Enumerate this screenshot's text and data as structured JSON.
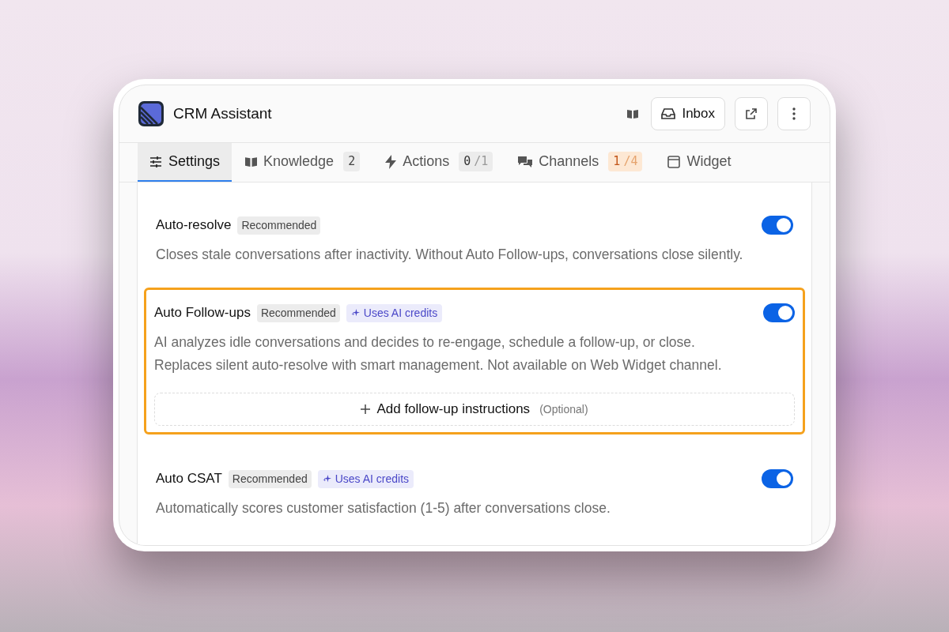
{
  "app": {
    "title": "CRM Assistant",
    "inbox_button": "Inbox"
  },
  "tabs": [
    {
      "label": "Settings",
      "selected": true
    },
    {
      "label": "Knowledge",
      "selected": false,
      "count": "2",
      "kind": "plain"
    },
    {
      "label": "Actions",
      "selected": false,
      "count": "0",
      "total": "/1",
      "kind": "neutral"
    },
    {
      "label": "Channels",
      "selected": false,
      "count": "1",
      "total": "/4",
      "kind": "warning"
    },
    {
      "label": "Widget",
      "selected": false
    }
  ],
  "settings": [
    {
      "title": "Auto-resolve",
      "badges": [
        {
          "kind": "recommended",
          "label": "Recommended"
        }
      ],
      "on": true,
      "highlighted": false,
      "description": "Closes stale conversations after inactivity. Without Auto Follow-ups, conversations close silently."
    },
    {
      "title": "Auto Follow-ups",
      "badges": [
        {
          "kind": "recommended",
          "label": "Recommended"
        },
        {
          "kind": "ai",
          "label": "Uses AI credits"
        }
      ],
      "on": true,
      "highlighted": true,
      "description": "AI analyzes idle conversations and decides to re-engage, schedule a follow-up, or close. Replaces silent auto-resolve with smart management. Not available on Web Widget channel.",
      "add_button": {
        "label": "Add follow-up instructions",
        "note": "(Optional)"
      }
    },
    {
      "title": "Auto CSAT",
      "badges": [
        {
          "kind": "recommended",
          "label": "Recommended"
        },
        {
          "kind": "ai",
          "label": "Uses AI credits"
        }
      ],
      "on": true,
      "highlighted": false,
      "description": "Automatically scores customer satisfaction (1-5) after conversations close."
    }
  ]
}
